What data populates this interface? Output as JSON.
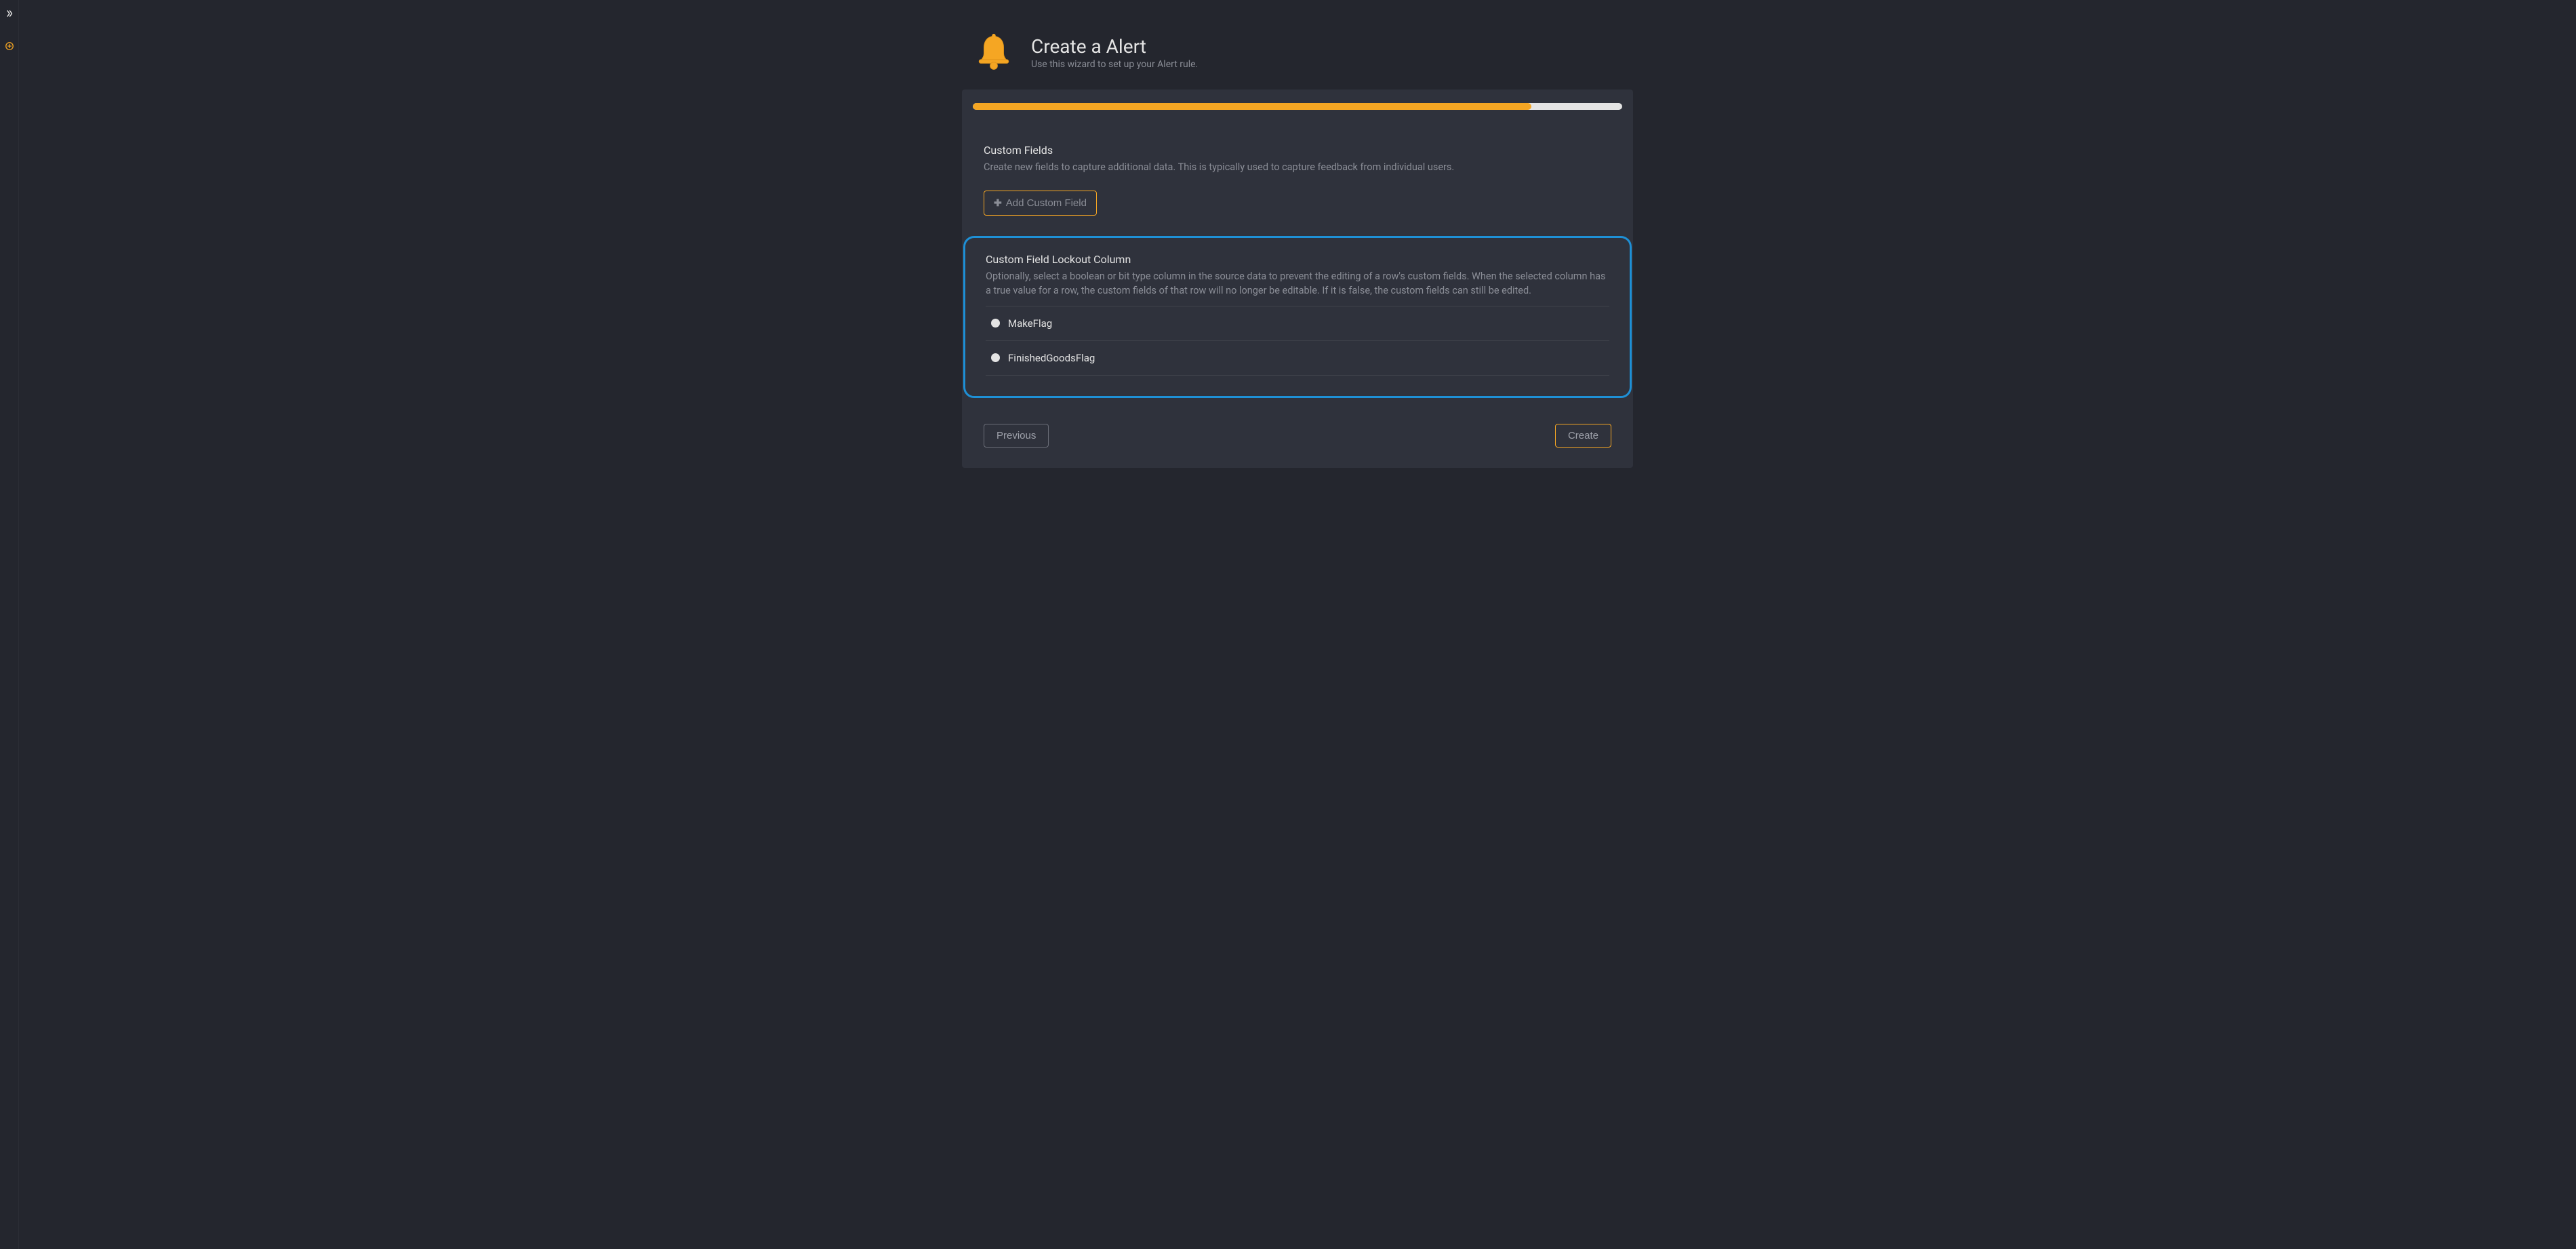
{
  "header": {
    "title": "Create a Alert",
    "subtitle": "Use this wizard to set up your Alert rule."
  },
  "progress": {
    "percent": 86
  },
  "custom_fields": {
    "title": "Custom Fields",
    "description": "Create new fields to capture additional data. This is typically used to capture feedback from individual users.",
    "add_button_label": "Add Custom Field"
  },
  "lockout": {
    "title": "Custom Field Lockout Column",
    "description": "Optionally, select a boolean or bit type column in the source data to prevent the editing of a row's custom fields. When the selected column has a true value for a row, the custom fields of that row will no longer be editable. If it is false, the custom fields can still be edited.",
    "options": [
      {
        "label": "MakeFlag",
        "selected": false
      },
      {
        "label": "FinishedGoodsFlag",
        "selected": false
      }
    ]
  },
  "footer": {
    "previous_label": "Previous",
    "create_label": "Create"
  },
  "icons": {
    "expand": "chevrons-right",
    "add": "plus-circle"
  }
}
